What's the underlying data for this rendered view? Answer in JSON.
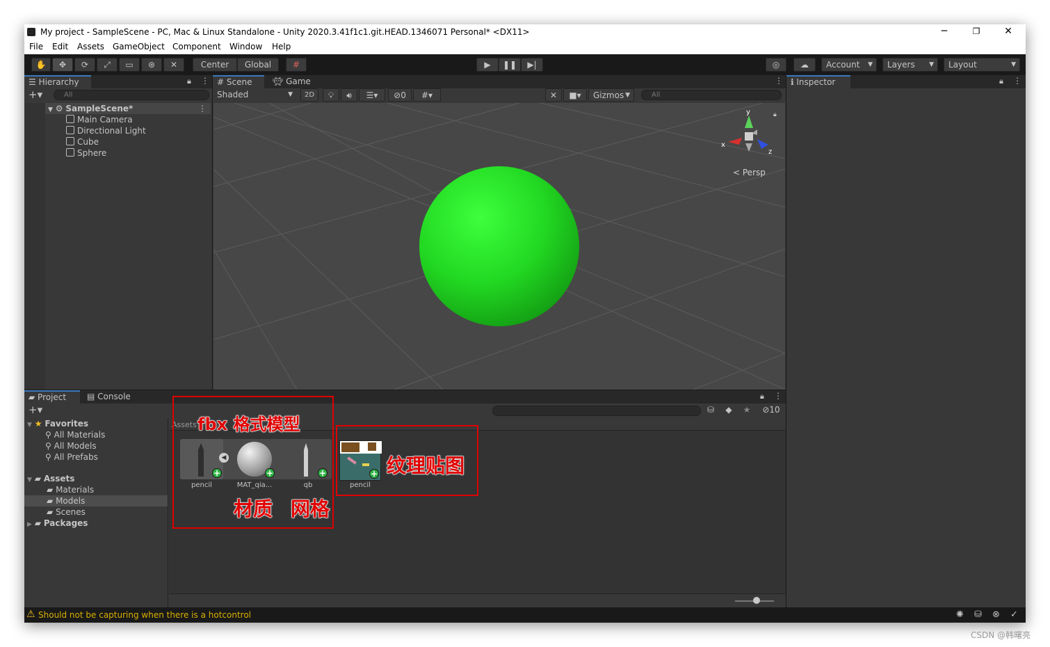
{
  "window": {
    "title": "My project - SampleScene - PC, Mac & Linux Standalone - Unity 2020.3.41f1c1.git.HEAD.1346071 Personal* <DX11>",
    "minimize": "─",
    "restore": "❐",
    "close": "✕"
  },
  "menu": [
    "File",
    "Edit",
    "Assets",
    "GameObject",
    "Component",
    "Window",
    "Help"
  ],
  "toolbar": {
    "center_label": "Center",
    "global_label": "Global",
    "account_label": "Account",
    "layers_label": "Layers",
    "layout_label": "Layout"
  },
  "hierarchy": {
    "tab_label": "Hierarchy",
    "search_placeholder": "All",
    "scene_name": "SampleScene*",
    "items": [
      "Main Camera",
      "Directional Light",
      "Cube",
      "Sphere"
    ]
  },
  "scene_view": {
    "scene_tab": "Scene",
    "game_tab": "Game",
    "shading_mode": "Shaded",
    "mode_2d": "2D",
    "hidden_count": "0",
    "gizmos_label": "Gizmos",
    "search_placeholder": "All",
    "persp_label": "Persp",
    "axis_y": "y",
    "axis_x": "x",
    "axis_z": "z",
    "sphere_color": "#22cc22"
  },
  "inspector": {
    "tab_label": "Inspector"
  },
  "project": {
    "project_tab": "Project",
    "console_tab": "Console",
    "breadcrumb": "Assets",
    "hidden_packages_count": "10",
    "tree": {
      "favorites_label": "Favorites",
      "favorites": [
        "All Materials",
        "All Models",
        "All Prefabs"
      ],
      "assets_label": "Assets",
      "assets_children": [
        "Materials",
        "Models",
        "Scenes"
      ],
      "packages_label": "Packages"
    },
    "assets": [
      {
        "label": "pencil"
      },
      {
        "label": "MAT_qia..."
      },
      {
        "label": "qb"
      },
      {
        "label": "pencil"
      }
    ]
  },
  "annotations": {
    "fbx_model": "fbx 格式模型",
    "material": "材质",
    "mesh": "网格",
    "texture": "纹理贴图"
  },
  "status": {
    "message": "Should not be capturing when there is a hotcontrol"
  },
  "watermark": "CSDN @韩曙亮"
}
